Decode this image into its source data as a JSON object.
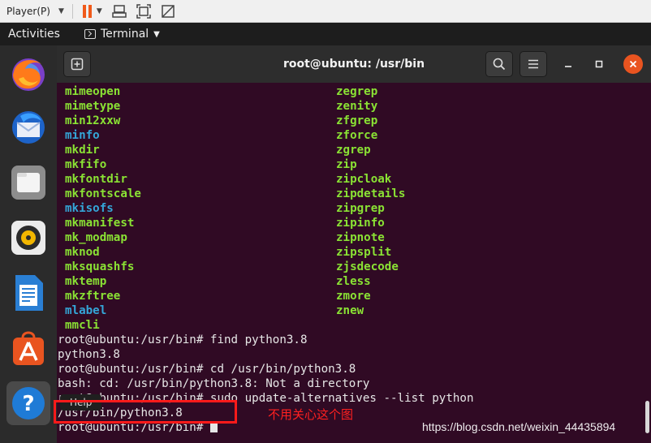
{
  "vmware": {
    "player_menu": "Player(P)"
  },
  "topbar": {
    "activities": "Activities",
    "app_name": "Terminal"
  },
  "dock": {
    "items": [
      "firefox-icon",
      "thunderbird-icon",
      "files-icon",
      "rhythmbox-icon",
      "libreoffice-writer-icon",
      "ubuntu-software-icon",
      "help-icon"
    ],
    "tooltip": "Help"
  },
  "terminal": {
    "title": "root@ubuntu: /usr/bin",
    "listing": [
      {
        "left": "mimeopen",
        "left_color": "green",
        "right": "zegrep",
        "right_color": "green"
      },
      {
        "left": "mimetype",
        "left_color": "green",
        "right": "zenity",
        "right_color": "green"
      },
      {
        "left": "min12xxw",
        "left_color": "green",
        "right": "zfgrep",
        "right_color": "green"
      },
      {
        "left": "minfo",
        "left_color": "blue",
        "right": "zforce",
        "right_color": "green"
      },
      {
        "left": "mkdir",
        "left_color": "green",
        "right": "zgrep",
        "right_color": "green"
      },
      {
        "left": "mkfifo",
        "left_color": "green",
        "right": "zip",
        "right_color": "green"
      },
      {
        "left": "mkfontdir",
        "left_color": "green",
        "right": "zipcloak",
        "right_color": "green"
      },
      {
        "left": "mkfontscale",
        "left_color": "green",
        "right": "zipdetails",
        "right_color": "green"
      },
      {
        "left": "mkisofs",
        "left_color": "blue",
        "right": "zipgrep",
        "right_color": "green"
      },
      {
        "left": "mkmanifest",
        "left_color": "green",
        "right": "zipinfo",
        "right_color": "green"
      },
      {
        "left": "mk_modmap",
        "left_color": "green",
        "right": "zipnote",
        "right_color": "green"
      },
      {
        "left": "mknod",
        "left_color": "green",
        "right": "zipsplit",
        "right_color": "green"
      },
      {
        "left": "mksquashfs",
        "left_color": "green",
        "right": "zjsdecode",
        "right_color": "green"
      },
      {
        "left": "mktemp",
        "left_color": "green",
        "right": "zless",
        "right_color": "green"
      },
      {
        "left": "mkzftree",
        "left_color": "green",
        "right": "zmore",
        "right_color": "green"
      },
      {
        "left": "mlabel",
        "left_color": "blue",
        "right": "znew",
        "right_color": "green"
      },
      {
        "left": "mmcli",
        "left_color": "green",
        "right": "",
        "right_color": "green"
      }
    ],
    "lines": [
      "root@ubuntu:/usr/bin# find python3.8",
      "python3.8",
      "root@ubuntu:/usr/bin# cd /usr/bin/python3.8",
      "bash: cd: /usr/bin/python3.8: Not a directory",
      "root@ubuntu:/usr/bin# sudo update-alternatives --list python",
      "/usr/bin/python3.8",
      "root@ubuntu:/usr/bin# "
    ]
  },
  "annotation": {
    "note": "不用关心这个图"
  },
  "watermark": "https://blog.csdn.net/weixin_44435894",
  "colors": {
    "terminal_bg": "#300a24",
    "exec_green": "#8ae234",
    "link_blue": "#34a6d8",
    "ubuntu_orange": "#e95420",
    "annotation_red": "#ff1a1a"
  }
}
